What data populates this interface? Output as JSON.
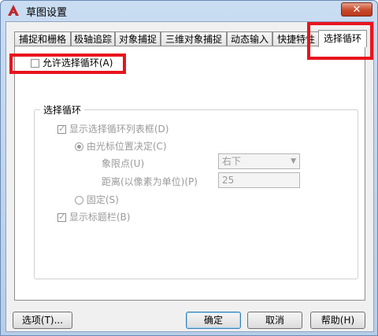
{
  "window": {
    "title": "草图设置",
    "close_label": "✕"
  },
  "tabs": [
    {
      "label": "捕捉和栅格",
      "active": false
    },
    {
      "label": "极轴追踪",
      "active": false
    },
    {
      "label": "对象捕捉",
      "active": false
    },
    {
      "label": "三维对象捕捉",
      "active": false
    },
    {
      "label": "动态输入",
      "active": false
    },
    {
      "label": "快捷特性",
      "active": false
    },
    {
      "label": "选择循环",
      "active": true
    }
  ],
  "allow_cycling": {
    "label": "允许选择循环(A)",
    "checked": false
  },
  "group": {
    "title": "选择循环",
    "show_list": {
      "label": "显示选择循环列表框(D)",
      "checked": true
    },
    "cursor_position": {
      "label": "由光标位置决定(C)",
      "selected": true
    },
    "quadrant": {
      "label": "象限点(U)",
      "value": "右下"
    },
    "distance": {
      "label": "距离(以像素为单位)(P)",
      "value": "25"
    },
    "fixed": {
      "label": "固定(S)",
      "selected": false
    },
    "show_titlebar": {
      "label": "显示标题栏(B)",
      "checked": true
    }
  },
  "buttons": {
    "options": "选项(T)...",
    "ok": "确定",
    "cancel": "取消",
    "help": "帮助(H)"
  },
  "colors": {
    "highlight": "#e8141d",
    "app_icon": "#c0262d"
  }
}
